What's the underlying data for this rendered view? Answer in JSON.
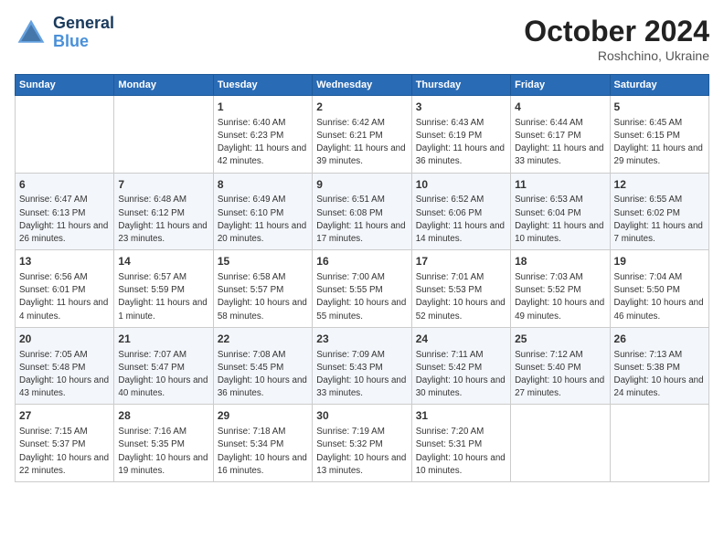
{
  "header": {
    "logo_line1": "General",
    "logo_line2": "Blue",
    "month": "October 2024",
    "location": "Roshchino, Ukraine"
  },
  "weekdays": [
    "Sunday",
    "Monday",
    "Tuesday",
    "Wednesday",
    "Thursday",
    "Friday",
    "Saturday"
  ],
  "weeks": [
    [
      {
        "day": "",
        "info": ""
      },
      {
        "day": "",
        "info": ""
      },
      {
        "day": "1",
        "info": "Sunrise: 6:40 AM\nSunset: 6:23 PM\nDaylight: 11 hours and 42 minutes."
      },
      {
        "day": "2",
        "info": "Sunrise: 6:42 AM\nSunset: 6:21 PM\nDaylight: 11 hours and 39 minutes."
      },
      {
        "day": "3",
        "info": "Sunrise: 6:43 AM\nSunset: 6:19 PM\nDaylight: 11 hours and 36 minutes."
      },
      {
        "day": "4",
        "info": "Sunrise: 6:44 AM\nSunset: 6:17 PM\nDaylight: 11 hours and 33 minutes."
      },
      {
        "day": "5",
        "info": "Sunrise: 6:45 AM\nSunset: 6:15 PM\nDaylight: 11 hours and 29 minutes."
      }
    ],
    [
      {
        "day": "6",
        "info": "Sunrise: 6:47 AM\nSunset: 6:13 PM\nDaylight: 11 hours and 26 minutes."
      },
      {
        "day": "7",
        "info": "Sunrise: 6:48 AM\nSunset: 6:12 PM\nDaylight: 11 hours and 23 minutes."
      },
      {
        "day": "8",
        "info": "Sunrise: 6:49 AM\nSunset: 6:10 PM\nDaylight: 11 hours and 20 minutes."
      },
      {
        "day": "9",
        "info": "Sunrise: 6:51 AM\nSunset: 6:08 PM\nDaylight: 11 hours and 17 minutes."
      },
      {
        "day": "10",
        "info": "Sunrise: 6:52 AM\nSunset: 6:06 PM\nDaylight: 11 hours and 14 minutes."
      },
      {
        "day": "11",
        "info": "Sunrise: 6:53 AM\nSunset: 6:04 PM\nDaylight: 11 hours and 10 minutes."
      },
      {
        "day": "12",
        "info": "Sunrise: 6:55 AM\nSunset: 6:02 PM\nDaylight: 11 hours and 7 minutes."
      }
    ],
    [
      {
        "day": "13",
        "info": "Sunrise: 6:56 AM\nSunset: 6:01 PM\nDaylight: 11 hours and 4 minutes."
      },
      {
        "day": "14",
        "info": "Sunrise: 6:57 AM\nSunset: 5:59 PM\nDaylight: 11 hours and 1 minute."
      },
      {
        "day": "15",
        "info": "Sunrise: 6:58 AM\nSunset: 5:57 PM\nDaylight: 10 hours and 58 minutes."
      },
      {
        "day": "16",
        "info": "Sunrise: 7:00 AM\nSunset: 5:55 PM\nDaylight: 10 hours and 55 minutes."
      },
      {
        "day": "17",
        "info": "Sunrise: 7:01 AM\nSunset: 5:53 PM\nDaylight: 10 hours and 52 minutes."
      },
      {
        "day": "18",
        "info": "Sunrise: 7:03 AM\nSunset: 5:52 PM\nDaylight: 10 hours and 49 minutes."
      },
      {
        "day": "19",
        "info": "Sunrise: 7:04 AM\nSunset: 5:50 PM\nDaylight: 10 hours and 46 minutes."
      }
    ],
    [
      {
        "day": "20",
        "info": "Sunrise: 7:05 AM\nSunset: 5:48 PM\nDaylight: 10 hours and 43 minutes."
      },
      {
        "day": "21",
        "info": "Sunrise: 7:07 AM\nSunset: 5:47 PM\nDaylight: 10 hours and 40 minutes."
      },
      {
        "day": "22",
        "info": "Sunrise: 7:08 AM\nSunset: 5:45 PM\nDaylight: 10 hours and 36 minutes."
      },
      {
        "day": "23",
        "info": "Sunrise: 7:09 AM\nSunset: 5:43 PM\nDaylight: 10 hours and 33 minutes."
      },
      {
        "day": "24",
        "info": "Sunrise: 7:11 AM\nSunset: 5:42 PM\nDaylight: 10 hours and 30 minutes."
      },
      {
        "day": "25",
        "info": "Sunrise: 7:12 AM\nSunset: 5:40 PM\nDaylight: 10 hours and 27 minutes."
      },
      {
        "day": "26",
        "info": "Sunrise: 7:13 AM\nSunset: 5:38 PM\nDaylight: 10 hours and 24 minutes."
      }
    ],
    [
      {
        "day": "27",
        "info": "Sunrise: 7:15 AM\nSunset: 5:37 PM\nDaylight: 10 hours and 22 minutes."
      },
      {
        "day": "28",
        "info": "Sunrise: 7:16 AM\nSunset: 5:35 PM\nDaylight: 10 hours and 19 minutes."
      },
      {
        "day": "29",
        "info": "Sunrise: 7:18 AM\nSunset: 5:34 PM\nDaylight: 10 hours and 16 minutes."
      },
      {
        "day": "30",
        "info": "Sunrise: 7:19 AM\nSunset: 5:32 PM\nDaylight: 10 hours and 13 minutes."
      },
      {
        "day": "31",
        "info": "Sunrise: 7:20 AM\nSunset: 5:31 PM\nDaylight: 10 hours and 10 minutes."
      },
      {
        "day": "",
        "info": ""
      },
      {
        "day": "",
        "info": ""
      }
    ]
  ]
}
